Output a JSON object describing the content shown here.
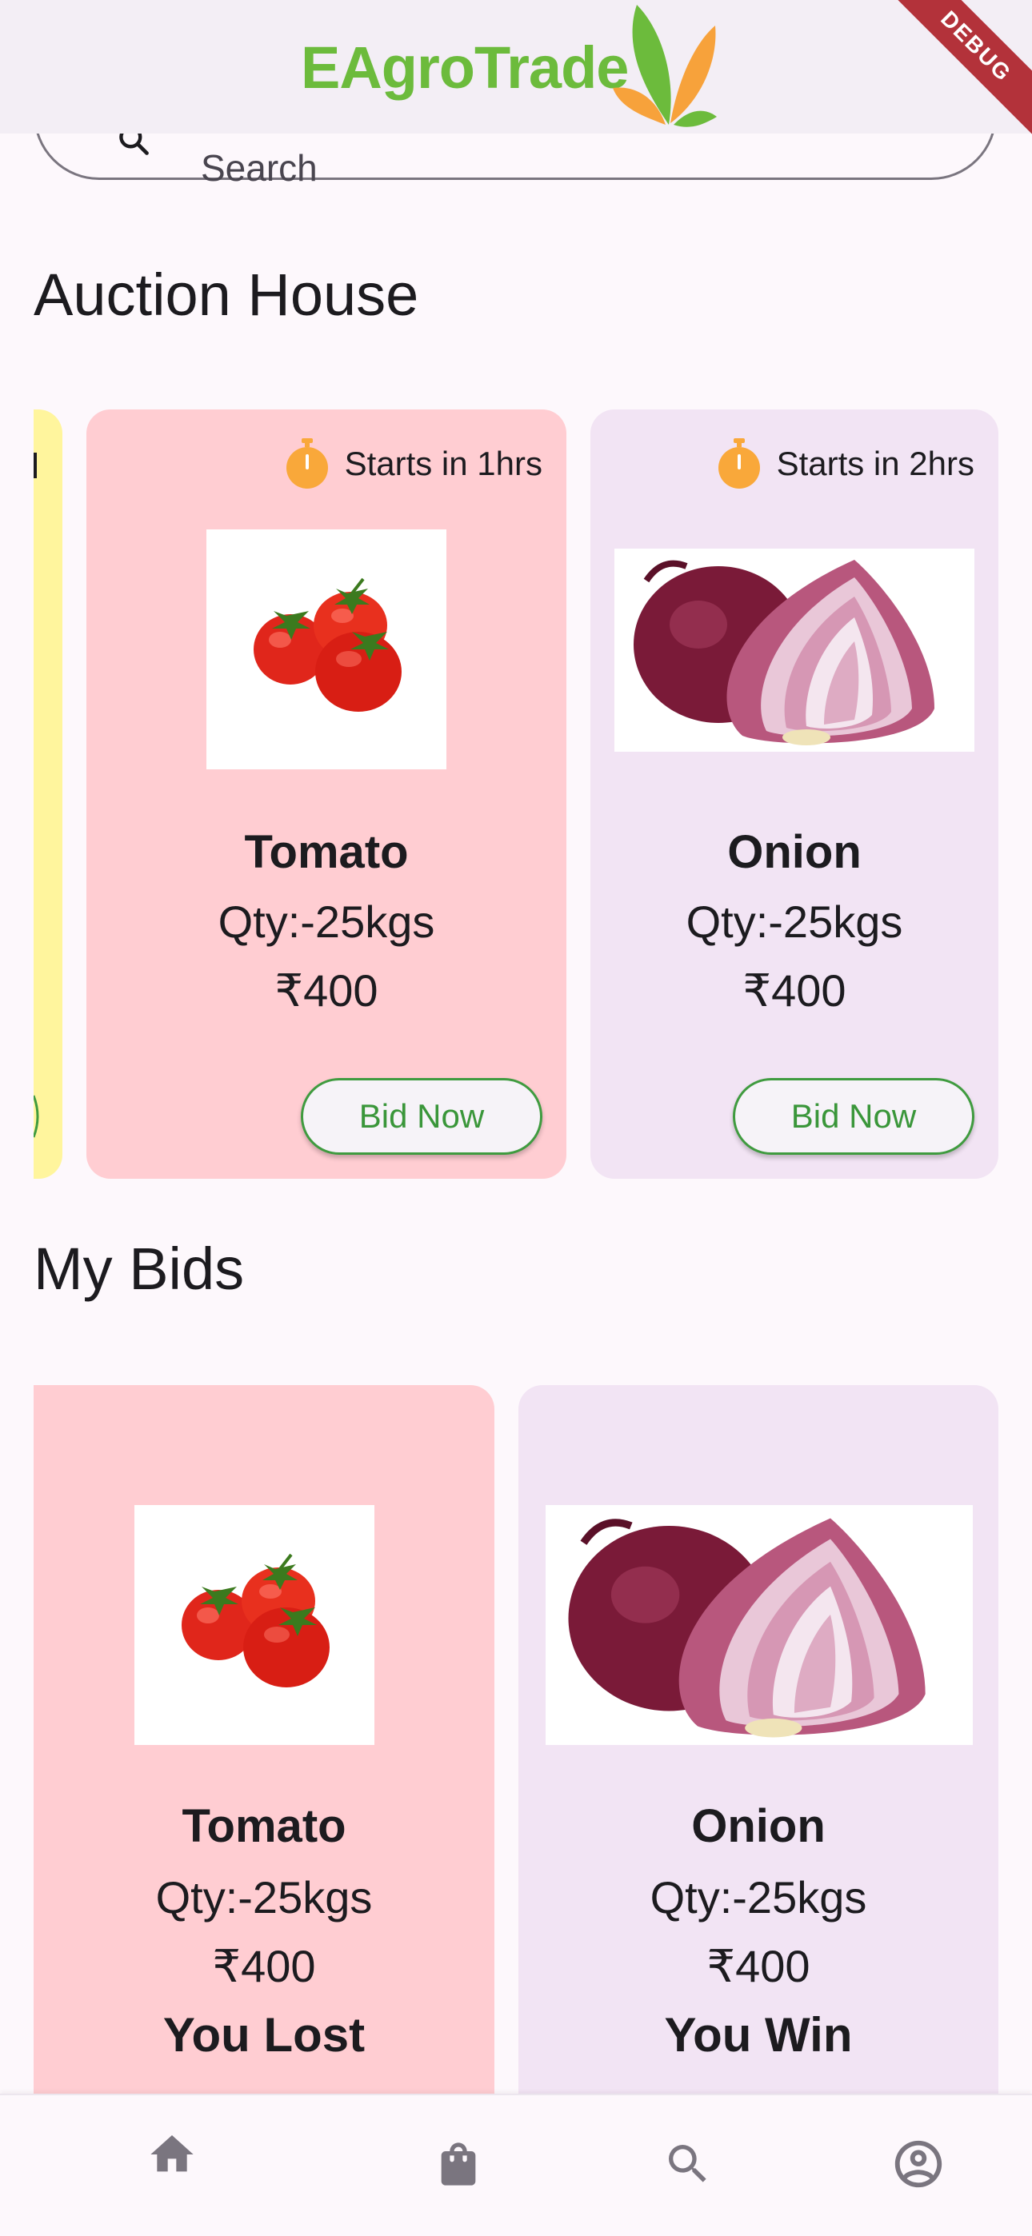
{
  "app": {
    "brand": "EAgroTrade",
    "debug_label": "DEBUG"
  },
  "search": {
    "placeholder": "Search"
  },
  "sections": {
    "auction_title": "Auction House",
    "bids_title": "My Bids"
  },
  "auction_items": [
    {
      "timer": "Starts in 1hrs",
      "name": "Tomato",
      "qty": "Qty:-25kgs",
      "price": "₹400",
      "button": "Bid Now",
      "bg": "#ffcdd2",
      "image": "tomato-image"
    },
    {
      "timer": "Starts in 2hrs",
      "name": "Onion",
      "qty": "Qty:-25kgs",
      "price": "₹400",
      "button": "Bid Now",
      "bg": "#f2e4f4",
      "image": "onion-image"
    }
  ],
  "partial_card_bg": "#fff59d",
  "my_bids": [
    {
      "name": "Tomato",
      "qty": "Qty:-25kgs",
      "price": "₹400",
      "result": "You Lost",
      "bg": "#ffcdd2",
      "image": "tomato-image"
    },
    {
      "name": "Onion",
      "qty": "Qty:-25kgs",
      "price": "₹400",
      "result": "You Win",
      "bg": "#f2e4f4",
      "image": "onion-image"
    }
  ],
  "nav": [
    "home-icon",
    "shopping-bag-icon",
    "search-icon",
    "account-circle-icon"
  ],
  "colors": {
    "brand_green": "#6cbb3c",
    "brand_orange": "#f7a23b",
    "button_green": "#3f9b3f",
    "timer_orange": "#f9a83a"
  }
}
